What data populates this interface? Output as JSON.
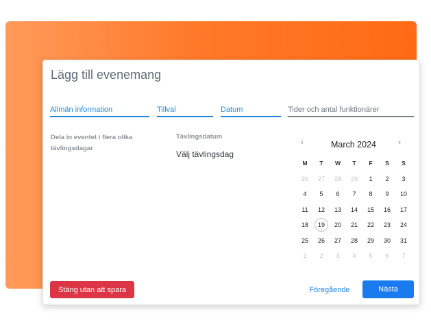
{
  "modal": {
    "title": "Lägg till evenemang"
  },
  "tabs": [
    {
      "label": "Allmän information",
      "active": true
    },
    {
      "label": "Tillval",
      "active": true
    },
    {
      "label": "Datum",
      "active": true
    },
    {
      "label": "Tider och antal funktionärer",
      "active": false
    }
  ],
  "left": {
    "multi_day_text": "Dela in eventet i flera olika tävlingsdagar"
  },
  "competition_date": {
    "label": "Tävlingsdatum",
    "value": "Välj tävlingsdag"
  },
  "calendar": {
    "month_title": "March 2024",
    "prev_icon": "‹",
    "next_icon": "›",
    "weekdays": [
      "M",
      "T",
      "W",
      "T",
      "F",
      "S",
      "S"
    ],
    "weeks": [
      [
        [
          "26",
          true
        ],
        [
          "27",
          true
        ],
        [
          "28",
          true
        ],
        [
          "29",
          true
        ],
        [
          "1",
          false
        ],
        [
          "2",
          false
        ],
        [
          "3",
          false
        ]
      ],
      [
        [
          "4",
          false
        ],
        [
          "5",
          false
        ],
        [
          "6",
          false
        ],
        [
          "7",
          false
        ],
        [
          "8",
          false
        ],
        [
          "9",
          false
        ],
        [
          "10",
          false
        ]
      ],
      [
        [
          "11",
          false
        ],
        [
          "12",
          false
        ],
        [
          "13",
          false
        ],
        [
          "14",
          false
        ],
        [
          "15",
          false
        ],
        [
          "16",
          false
        ],
        [
          "17",
          false
        ]
      ],
      [
        [
          "18",
          false
        ],
        [
          "19",
          false
        ],
        [
          "20",
          false
        ],
        [
          "21",
          false
        ],
        [
          "22",
          false
        ],
        [
          "23",
          false
        ],
        [
          "24",
          false
        ]
      ],
      [
        [
          "25",
          false
        ],
        [
          "26",
          false
        ],
        [
          "27",
          false
        ],
        [
          "28",
          false
        ],
        [
          "29",
          false
        ],
        [
          "30",
          false
        ],
        [
          "31",
          false
        ]
      ],
      [
        [
          "1",
          true
        ],
        [
          "2",
          true
        ],
        [
          "3",
          true
        ],
        [
          "4",
          true
        ],
        [
          "5",
          true
        ],
        [
          "6",
          true
        ],
        [
          "7",
          true
        ]
      ]
    ],
    "today": "19"
  },
  "buttons": {
    "close": "Stäng utan att spara",
    "previous": "Föregående",
    "next": "Nästa"
  },
  "colors": {
    "accent": "#1f86e0",
    "danger": "#dc3545",
    "background_gradient_start": "#ff9a5a",
    "background_gradient_end": "#ff6a14"
  }
}
